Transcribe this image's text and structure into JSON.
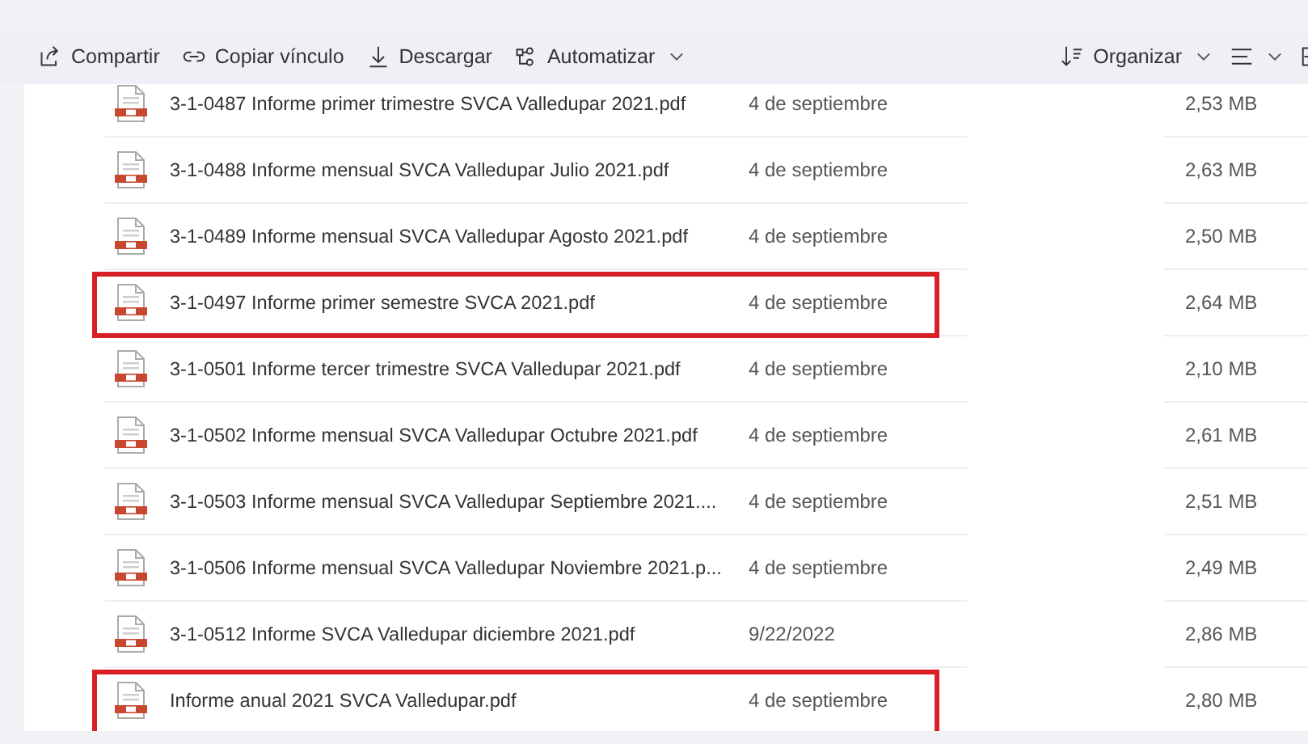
{
  "toolbar": {
    "left": [
      {
        "kind": "share",
        "label": "Compartir",
        "dropdown": false
      },
      {
        "kind": "link",
        "label": "Copiar vínculo",
        "dropdown": false
      },
      {
        "kind": "download",
        "label": "Descargar",
        "dropdown": false
      },
      {
        "kind": "automate",
        "label": "Automatizar",
        "dropdown": true
      }
    ],
    "right": [
      {
        "kind": "sort",
        "label": "Organizar",
        "dropdown": true
      },
      {
        "kind": "view",
        "dropdown": true
      },
      {
        "kind": "details",
        "dropdown": false
      }
    ]
  },
  "files": [
    {
      "name": "3-1-0487 Informe primer trimestre SVCA Valledupar 2021.pdf",
      "modified": "4 de septiembre",
      "size": "2,53 MB",
      "highlighted": false
    },
    {
      "name": "3-1-0488 Informe mensual SVCA Valledupar Julio 2021.pdf",
      "modified": "4 de septiembre",
      "size": "2,63 MB",
      "highlighted": false
    },
    {
      "name": "3-1-0489 Informe mensual SVCA Valledupar Agosto 2021.pdf",
      "modified": "4 de septiembre",
      "size": "2,50 MB",
      "highlighted": false
    },
    {
      "name": "3-1-0497 Informe primer semestre SVCA 2021.pdf",
      "modified": "4 de septiembre",
      "size": "2,64 MB",
      "highlighted": true
    },
    {
      "name": "3-1-0501 Informe tercer trimestre SVCA Valledupar 2021.pdf",
      "modified": "4 de septiembre",
      "size": "2,10 MB",
      "highlighted": false
    },
    {
      "name": "3-1-0502 Informe mensual SVCA Valledupar Octubre 2021.pdf",
      "modified": "4 de septiembre",
      "size": "2,61 MB",
      "highlighted": false
    },
    {
      "name": "3-1-0503 Informe mensual SVCA Valledupar Septiembre 2021....",
      "modified": "4 de septiembre",
      "size": "2,51 MB",
      "highlighted": false
    },
    {
      "name": "3-1-0506 Informe mensual SVCA Valledupar Noviembre 2021.p...",
      "modified": "4 de septiembre",
      "size": "2,49 MB",
      "highlighted": false
    },
    {
      "name": "3-1-0512 Informe SVCA Valledupar diciembre 2021.pdf",
      "modified": "9/22/2022",
      "size": "2,86 MB",
      "highlighted": false
    },
    {
      "name": "Informe anual 2021 SVCA Valledupar.pdf",
      "modified": "4 de septiembre",
      "size": "2,80 MB",
      "highlighted": true
    }
  ]
}
